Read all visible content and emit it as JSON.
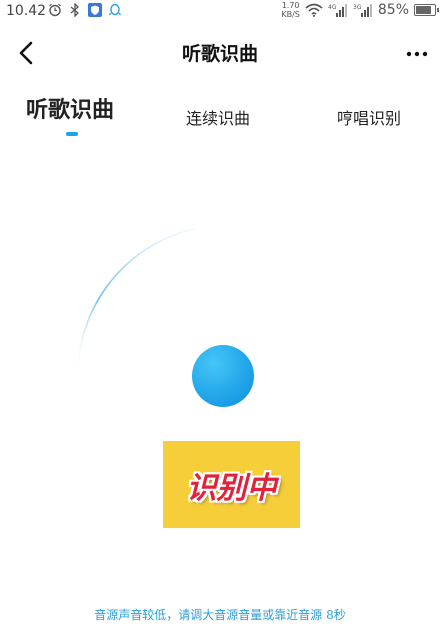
{
  "status_bar": {
    "time": "10.42",
    "speed_value": "1.70",
    "speed_unit": "KB/S",
    "battery_percent": "85%",
    "battery_level": 0.85,
    "icons": [
      "alarm-icon",
      "bluetooth-icon",
      "shield-icon",
      "qq-icon",
      "wifi-icon",
      "signal-4g-icon",
      "signal-3g-icon",
      "battery-icon"
    ]
  },
  "nav": {
    "title": "听歌识曲",
    "back_icon": "chevron-left-icon",
    "more_icon": "more-dots-icon"
  },
  "tabs": [
    {
      "label": "听歌识曲",
      "active": true
    },
    {
      "label": "连续识曲",
      "active": false
    },
    {
      "label": "哼唱识别",
      "active": false
    }
  ],
  "recognition": {
    "status_label": "识别中",
    "hint": "音源声音较低，请调大音源音量或靠近音源 8秒"
  },
  "colors": {
    "accent": "#1aa3e8",
    "badge_bg": "#f6ce3a",
    "badge_text": "#e0233a"
  }
}
